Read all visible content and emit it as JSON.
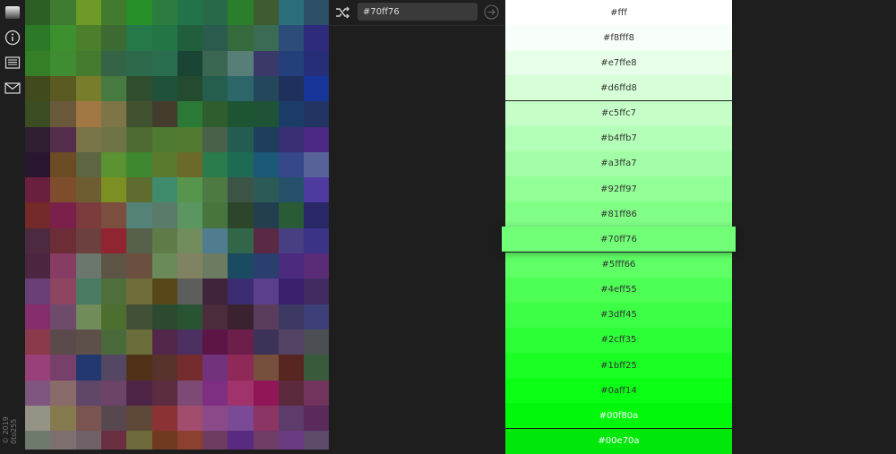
{
  "sidebar": {
    "logo_icon": "gradient-logo-icon",
    "info_icon": "info-icon",
    "list_icon": "list-icon",
    "mail_icon": "mail-icon",
    "copyright": [
      "© 2019",
      "0to255"
    ]
  },
  "toolbar": {
    "shuffle_icon": "shuffle-icon",
    "input_value": "#70ff76",
    "go_icon": "arrow-right-circle-icon"
  },
  "grid_colors": [
    [
      "#2d5e26",
      "#3f7b30",
      "#6e9a28",
      "#427a2f",
      "#269027",
      "#2c7c40",
      "#22734a",
      "#28694a",
      "#2a7f2c",
      "#3e5c2f",
      "#2c6f7c",
      "#2d4f68"
    ],
    [
      "#2c7a27",
      "#3c902e",
      "#4c7e2c",
      "#3d6a33",
      "#257849",
      "#237546",
      "#215e3c",
      "#2b5a4e",
      "#356a3c",
      "#3b6b54",
      "#2b4d78",
      "#2d2b7c"
    ],
    [
      "#347f28",
      "#3f8c32",
      "#447b2e",
      "#356346",
      "#2d6a4b",
      "#2a6e4f",
      "#1a4535",
      "#3b6651",
      "#577e77",
      "#3b386a",
      "#23407a",
      "#262e78"
    ],
    [
      "#404a1c",
      "#5b5a22",
      "#787d2b",
      "#467a41",
      "#304d2e",
      "#20513a",
      "#244b30",
      "#245e4e",
      "#2c6669",
      "#25475c",
      "#20305c",
      "#173599"
    ],
    [
      "#3b4d22",
      "#69583a",
      "#a17844",
      "#7d7548",
      "#415231",
      "#443c2d",
      "#2a7937",
      "#305d2d",
      "#1d5431",
      "#1f5338",
      "#1d3d69",
      "#223462"
    ],
    [
      "#301f33",
      "#542d4d",
      "#7a7548",
      "#6f7447",
      "#4d6b32",
      "#4e7a32",
      "#527a30",
      "#4a6048",
      "#245c52",
      "#1e3e5c",
      "#3a2f74",
      "#4a2a84"
    ],
    [
      "#2a1530",
      "#6b4c25",
      "#5c6640",
      "#5b9232",
      "#3d8830",
      "#5c7a2d",
      "#6c6a2a",
      "#2b7c4c",
      "#1e6b53",
      "#1c5878",
      "#36478a",
      "#576398"
    ],
    [
      "#6a1f3f",
      "#7e4d2c",
      "#6d5d30",
      "#7c8f22",
      "#5e6d2f",
      "#3f8c6d",
      "#58954c",
      "#4c7a42",
      "#3b5446",
      "#2c5a56",
      "#25516a",
      "#4f3aa0"
    ],
    [
      "#732a28",
      "#7a204a",
      "#7c3b3c",
      "#7c4e40",
      "#558276",
      "#5a7a6a",
      "#5b9660",
      "#48753e",
      "#2d452a",
      "#233e4f",
      "#2a5b37",
      "#2a2866"
    ],
    [
      "#4c2a40",
      "#6c2d36",
      "#6d4040",
      "#902430",
      "#56604a",
      "#5f7c48",
      "#738c5d",
      "#4f7c8f",
      "#326648",
      "#5a2a44",
      "#473f82",
      "#3a3386"
    ],
    [
      "#4a2640",
      "#873c63",
      "#6b776c",
      "#5c5444",
      "#6b5040",
      "#6b8a5a",
      "#818262",
      "#6c7c60",
      "#1b4a63",
      "#2a3f6e",
      "#4b2b7e",
      "#5a2c78"
    ],
    [
      "#6a3f75",
      "#8e4561",
      "#4a7a62",
      "#4f6e3c",
      "#6f6e3a",
      "#584718",
      "#5c5e5c",
      "#40243c",
      "#3a2d72",
      "#5b3f8e",
      "#3b2070",
      "#402a60"
    ],
    [
      "#842f6c",
      "#6e4b6b",
      "#718b5a",
      "#4d6e2e",
      "#435038",
      "#2c4a30",
      "#285434",
      "#4a2c3c",
      "#3a2230",
      "#5a3c5c",
      "#3d3963",
      "#3d3f78"
    ],
    [
      "#8a3a4a",
      "#5a4a4c",
      "#5c5048",
      "#4a6a3c",
      "#6b6e3b",
      "#53274a",
      "#4c3062",
      "#5d1546",
      "#6c1f4a",
      "#3d3358",
      "#544264",
      "#4b4e52"
    ],
    [
      "#99407a",
      "#76406b",
      "#22386e",
      "#544764",
      "#513218",
      "#58322c",
      "#752c2e",
      "#73337c",
      "#8e2958",
      "#76503c",
      "#582620",
      "#3a5a3c"
    ],
    [
      "#7e5680",
      "#896b6a",
      "#60476a",
      "#6b4468",
      "#4e2546",
      "#5c2d40",
      "#7c4a74",
      "#7e2f82",
      "#a0326c",
      "#901658",
      "#5c2a3c",
      "#72345c"
    ],
    [
      "#949386",
      "#857a4e",
      "#7a5450",
      "#574850",
      "#5e4838",
      "#8a3234",
      "#a24c6e",
      "#8a4a88",
      "#7a4a96",
      "#8b3564",
      "#5d3c6b",
      "#5a2a5a"
    ],
    [
      "#6e7a6c",
      "#7e7070",
      "#706068",
      "#6a3042",
      "#6e6a3c",
      "#6f3a20",
      "#8c4030",
      "#6e3c60",
      "#592a82",
      "#6e3c64",
      "#6a3a80",
      "#5e4b6c"
    ]
  ],
  "palette": {
    "selected": "#70ff76",
    "swatches": [
      {
        "hex": "#fff",
        "bg": "#ffffff",
        "fg": "#333333"
      },
      {
        "hex": "#f8fff8",
        "bg": "#f8fff8",
        "fg": "#333333"
      },
      {
        "hex": "#e7ffe8",
        "bg": "#e7ffe8",
        "fg": "#333333"
      },
      {
        "hex": "#d6ffd8",
        "bg": "#d6ffd8",
        "fg": "#333333"
      },
      {
        "hex": "#c5ffc7",
        "bg": "#c5ffc7",
        "fg": "#333333"
      },
      {
        "hex": "#b4ffb7",
        "bg": "#b4ffb7",
        "fg": "#333333"
      },
      {
        "hex": "#a3ffa7",
        "bg": "#a3ffa7",
        "fg": "#333333"
      },
      {
        "hex": "#92ff97",
        "bg": "#92ff97",
        "fg": "#333333"
      },
      {
        "hex": "#81ff86",
        "bg": "#81ff86",
        "fg": "#333333"
      },
      {
        "hex": "#70ff76",
        "bg": "#70ff76",
        "fg": "#333333"
      },
      {
        "hex": "#5fff66",
        "bg": "#5fff66",
        "fg": "#333333"
      },
      {
        "hex": "#4eff55",
        "bg": "#4eff55",
        "fg": "#333333"
      },
      {
        "hex": "#3dff45",
        "bg": "#3dff45",
        "fg": "#333333"
      },
      {
        "hex": "#2cff35",
        "bg": "#2cff35",
        "fg": "#333333"
      },
      {
        "hex": "#1bff25",
        "bg": "#1bff25",
        "fg": "#333333"
      },
      {
        "hex": "#0aff14",
        "bg": "#0aff14",
        "fg": "#333333"
      },
      {
        "hex": "#00f80a",
        "bg": "#00f80a",
        "fg": "#ffffff"
      },
      {
        "hex": "#00e70a",
        "bg": "#00e70a",
        "fg": "#ffffff"
      }
    ]
  }
}
